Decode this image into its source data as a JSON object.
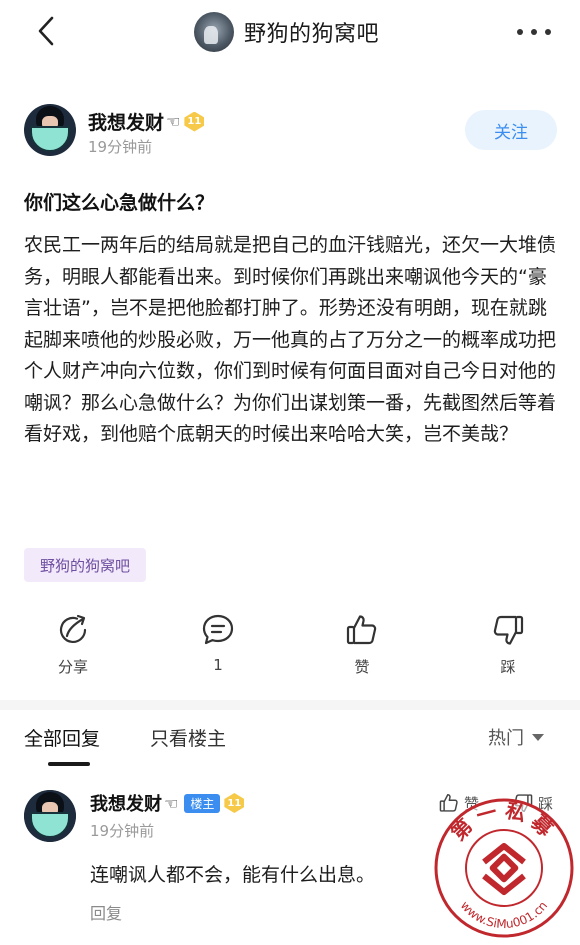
{
  "header": {
    "forum_name": "野狗的狗窝吧"
  },
  "author": {
    "name": "我想发财",
    "hand_emoji": "☜",
    "level": "11",
    "time": "19分钟前",
    "follow_label": "关注"
  },
  "post": {
    "title": "你们这么心急做什么？",
    "body": "农民工一两年后的结局就是把自己的血汗钱赔光，还欠一大堆债务，明眼人都能看出来。到时候你们再跳出来嘲讽他今天的“豪言壮语”，岂不是把他脸都打肿了。形势还没有明朗，现在就跳起脚来喷他的炒股必败，万一他真的占了万分之一的概率成功把个人财产冲向六位数，你们到时候有何面目面对自己今日对他的嘲讽？那么心急做什么？为你们出谋划策一番，先截图然后等着看好戏，到他赔个底朝天的时候出来哈哈大笑，岂不美哉？",
    "tag": "野狗的狗窝吧"
  },
  "actions": {
    "share_label": "分享",
    "comment_count": "1",
    "like_label": "赞",
    "dislike_label": "踩"
  },
  "replies": {
    "tab_all": "全部回复",
    "tab_owner": "只看楼主",
    "sort_label": "热门"
  },
  "comment": {
    "name": "我想发财",
    "hand_emoji": "☜",
    "owner_badge": "楼主",
    "level": "11",
    "time": "19分钟前",
    "text": "连嘲讽人都不会，能有什么出息。",
    "reply_label": "回复",
    "like_label": "赞",
    "dislike_label": "踩"
  },
  "watermark": {
    "top_text": "第一私募",
    "url_text": "www.SiMu001.cn",
    "color": "#c0282d"
  },
  "colors": {
    "accent": "#3b8ef0",
    "tag_bg": "#f2e9fb",
    "tag_text": "#6f4fa0",
    "level_badge": "#f7c948"
  }
}
